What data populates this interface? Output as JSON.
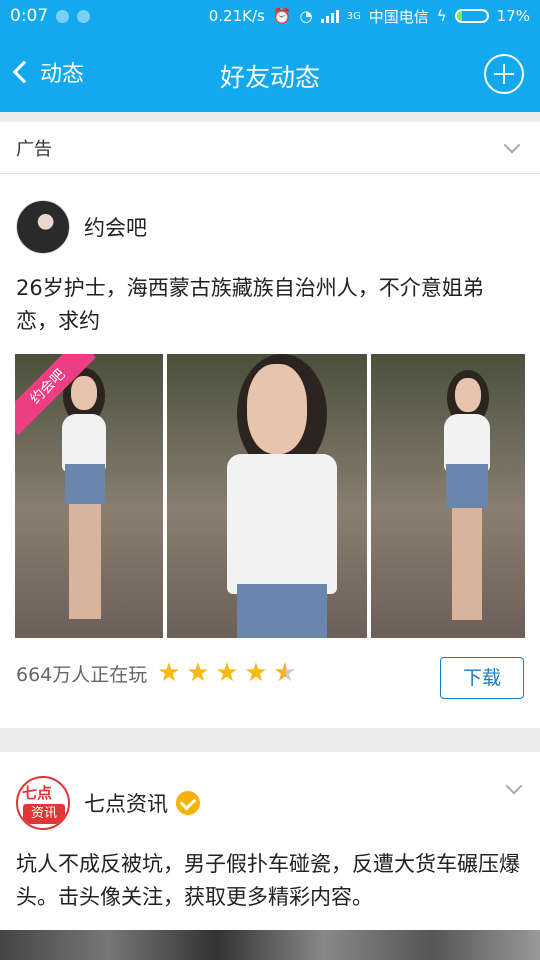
{
  "status_bar": {
    "time": "0:07",
    "speed": "0.21K/s",
    "network_tag": "3G",
    "carrier": "中国电信",
    "battery_percent": "17%",
    "battery_level": 0.17
  },
  "nav": {
    "back_label": "动态",
    "title": "好友动态"
  },
  "ad_post": {
    "label": "广告",
    "author": "约会吧",
    "text": "26岁护士，海西蒙古族藏族自治州人，不介意姐弟恋，求约",
    "photo_tag": "约会吧",
    "players": "664万人正在玩",
    "rating": 4.5,
    "download_label": "下载"
  },
  "post2": {
    "avatar_line1": "七点",
    "avatar_line2": "资讯",
    "author": "七点资讯",
    "text": "坑人不成反被坑，男子假扑车碰瓷，反遭大货车碾压爆头。击头像关注，获取更多精彩内容。"
  }
}
